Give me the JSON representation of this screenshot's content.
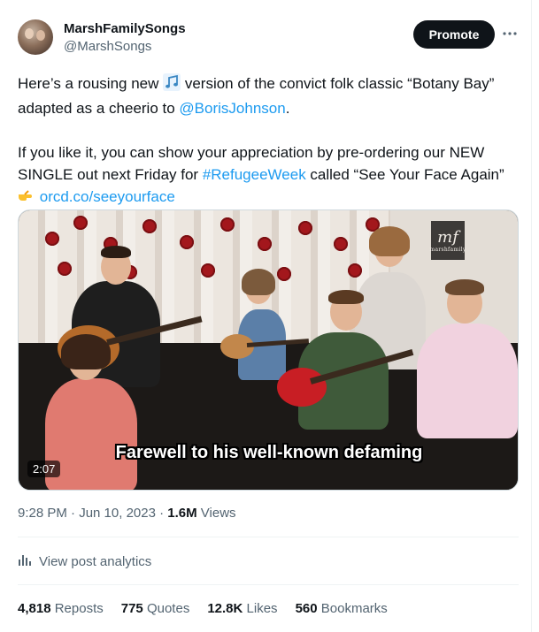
{
  "author": {
    "display_name": "MarshFamilySongs",
    "handle": "@MarshSongs",
    "avatar_icon": "profile-avatar"
  },
  "actions": {
    "promote_label": "Promote",
    "more_icon": "more-horizontal-icon"
  },
  "post": {
    "line1_pre": "Here’s a rousing new ",
    "music_emoji": "🎶",
    "line1_post": " version of the convict folk classic “Botany Bay” adapted as a cheerio to ",
    "mention": "@BorisJohnson",
    "line1_end": ".",
    "line2_pre": "If you like it, you can show your appreciation by pre-ordering our NEW SINGLE out next Friday for ",
    "hashtag": "#RefugeeWeek",
    "line2_post": " called “See Your Face Again”",
    "point_emoji": "👉",
    "url": "orcd.co/seeyourface"
  },
  "video": {
    "caption": "Farewell to his well-known defaming",
    "duration": "2:07",
    "logo_text": "mf",
    "logo_subtext": "marshfamily"
  },
  "meta": {
    "timestamp": "9:28 PM · Jun 10, 2023 · ",
    "views_count": "1.6M",
    "views_label": " Views"
  },
  "analytics": {
    "label": "View post analytics",
    "icon": "analytics-bar-icon"
  },
  "stats": {
    "reposts_count": "4,818",
    "reposts_label": "Reposts",
    "quotes_count": "775",
    "quotes_label": "Quotes",
    "likes_count": "12.8K",
    "likes_label": "Likes",
    "bookmarks_count": "560",
    "bookmarks_label": "Bookmarks"
  },
  "colors": {
    "link": "#1d9bf0",
    "text": "#0f1419",
    "muted": "#536471",
    "promote_bg": "#0f1419"
  }
}
